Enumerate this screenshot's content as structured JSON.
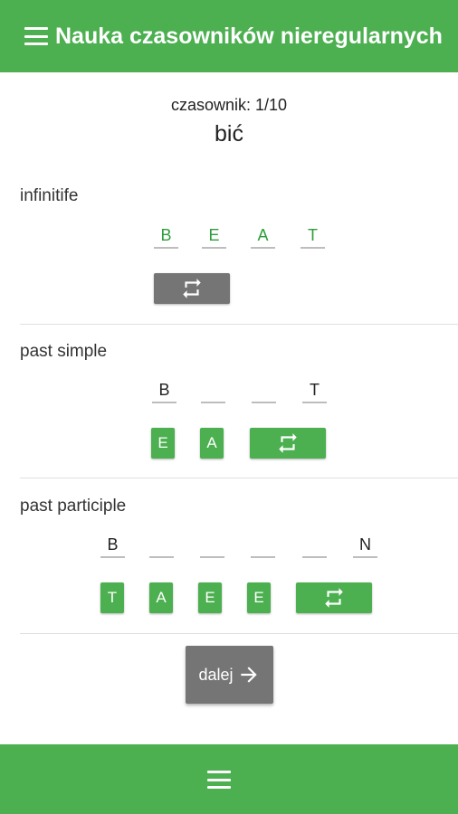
{
  "app_bar": {
    "title": "Nauka czasowników nieregularnych",
    "menu_icon": "menu-icon"
  },
  "counter": "czasownik: 1/10",
  "verb": "bić",
  "sections": {
    "infinitive": {
      "label": "infinitife",
      "slots": [
        "B",
        "E",
        "A",
        "T"
      ],
      "letters": [],
      "shuffle_icon": "repeat-icon"
    },
    "past_simple": {
      "label": "past simple",
      "slots": [
        "B",
        "",
        "",
        "T"
      ],
      "letters": [
        "E",
        "A"
      ],
      "shuffle_icon": "repeat-icon"
    },
    "past_participle": {
      "label": "past participle",
      "slots": [
        "B",
        "",
        "",
        "",
        "",
        "N"
      ],
      "letters": [
        "T",
        "A",
        "E",
        "E"
      ],
      "shuffle_icon": "repeat-icon"
    }
  },
  "next_button": {
    "label": "dalej",
    "icon": "arrow-right-icon"
  },
  "bottom_bar": {
    "menu_icon": "menu-icon"
  },
  "colors": {
    "primary": "#4caf50",
    "completed_text": "#2e9d3a",
    "disabled_button": "#757575"
  }
}
